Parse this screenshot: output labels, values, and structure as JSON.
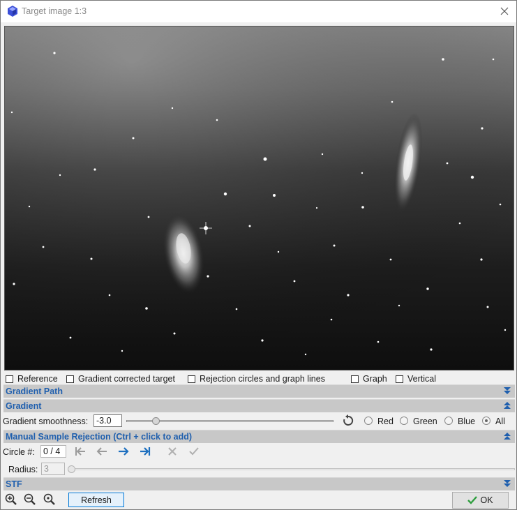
{
  "window": {
    "title": "Target image 1:3",
    "close_icon": "close-icon"
  },
  "options": {
    "reference": "Reference",
    "gradient_corrected_target": "Gradient corrected target",
    "rejection_circles": "Rejection circles and graph lines",
    "graph": "Graph",
    "vertical": "Vertical"
  },
  "sections": {
    "gradient_path": "Gradient Path",
    "gradient": "Gradient",
    "manual_rejection": "Manual Sample Rejection (Ctrl + click to add)",
    "stf": "STF"
  },
  "gradient": {
    "smoothness_label": "Gradient smoothness:",
    "smoothness_value": "-3.0",
    "smoothness_level_fraction": 0.13,
    "channels": [
      "Red",
      "Green",
      "Blue",
      "All"
    ],
    "selected_channel": "All"
  },
  "rejection": {
    "circle_label": "Circle #:",
    "circle_value": "0 / 4",
    "radius_label": "Radius:",
    "radius_value": "3"
  },
  "footer": {
    "refresh_label": "Refresh",
    "ok_label": "OK"
  },
  "colors": {
    "accent": "#1f5fae",
    "ok_check": "#2e9e3e",
    "nav_active": "#1d6fbf"
  }
}
